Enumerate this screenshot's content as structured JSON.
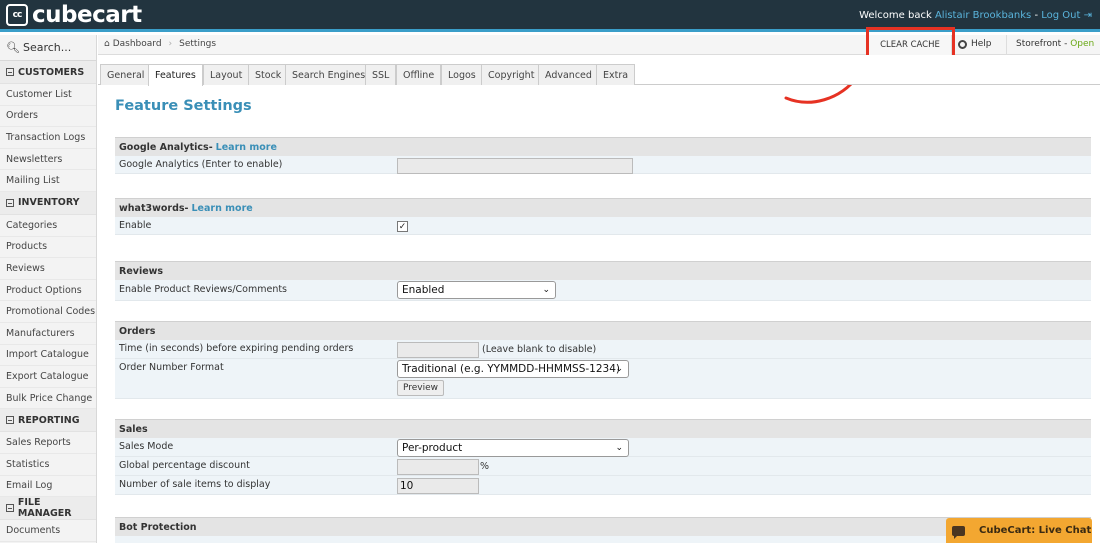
{
  "app": {
    "logo_mark": "cc",
    "logo_text": "cubecart"
  },
  "topbar": {
    "welcome": "Welcome back",
    "user": "Alistair Brookbanks",
    "dash": " - ",
    "logout": "Log Out"
  },
  "sidebar": {
    "search_placeholder": "Search...",
    "groups": [
      {
        "title": "CUSTOMERS",
        "items": [
          "Customer List",
          "Orders",
          "Transaction Logs",
          "Newsletters",
          "Mailing List"
        ]
      },
      {
        "title": "INVENTORY",
        "items": [
          "Categories",
          "Products",
          "Reviews",
          "Product Options",
          "Promotional Codes",
          "Manufacturers",
          "Import Catalogue",
          "Export Catalogue",
          "Bulk Price Change"
        ]
      },
      {
        "title": "REPORTING",
        "items": [
          "Sales Reports",
          "Statistics",
          "Email Log"
        ]
      },
      {
        "title": "FILE MANAGER",
        "items": [
          "Documents"
        ]
      }
    ]
  },
  "breadcrumb": {
    "home": "Dashboard",
    "current": "Settings"
  },
  "toolbar": {
    "clear_cache": "CLEAR CACHE",
    "help": "Help",
    "storefront": "Storefront",
    "storefront_sep": " - ",
    "storefront_status": "Open"
  },
  "tabs": [
    "General",
    "Features",
    "Layout",
    "Stock",
    "Search Engines",
    "SSL",
    "Offline",
    "Logos",
    "Copyright",
    "Advanced",
    "Extra"
  ],
  "active_tab": "Features",
  "page": {
    "title": "Feature Settings"
  },
  "sections": {
    "ga": {
      "title": "Google Analytics",
      "sep": " - ",
      "link": "Learn more",
      "field_label": "Google Analytics (Enter to enable)",
      "value": ""
    },
    "w3w": {
      "title": "what3words",
      "sep": " - ",
      "link": "Learn more",
      "enable_label": "Enable",
      "enabled": true,
      "check_glyph": "✓"
    },
    "reviews": {
      "title": "Reviews",
      "label": "Enable Product Reviews/Comments",
      "value": "Enabled"
    },
    "orders": {
      "title": "Orders",
      "expire_label": "Time (in seconds) before expiring pending orders",
      "expire_hint": "(Leave blank to disable)",
      "format_label": "Order Number Format",
      "format_value": "Traditional (e.g. YYMMDD-HHMMSS-1234)",
      "preview": "Preview"
    },
    "sales": {
      "title": "Sales",
      "mode_label": "Sales Mode",
      "mode_value": "Per-product",
      "discount_label": "Global percentage discount",
      "discount_suffix": "%",
      "items_label": "Number of sale items to display",
      "items_value": "10"
    },
    "bot": {
      "title": "Bot Protection"
    }
  },
  "livechat": {
    "label": "CubeCart: Live Chat"
  },
  "colors": {
    "topbar": "#22343f",
    "accent": "#3a9ec9",
    "highlight": "#e63223",
    "chat": "#f3a731",
    "open": "#6aa816"
  }
}
